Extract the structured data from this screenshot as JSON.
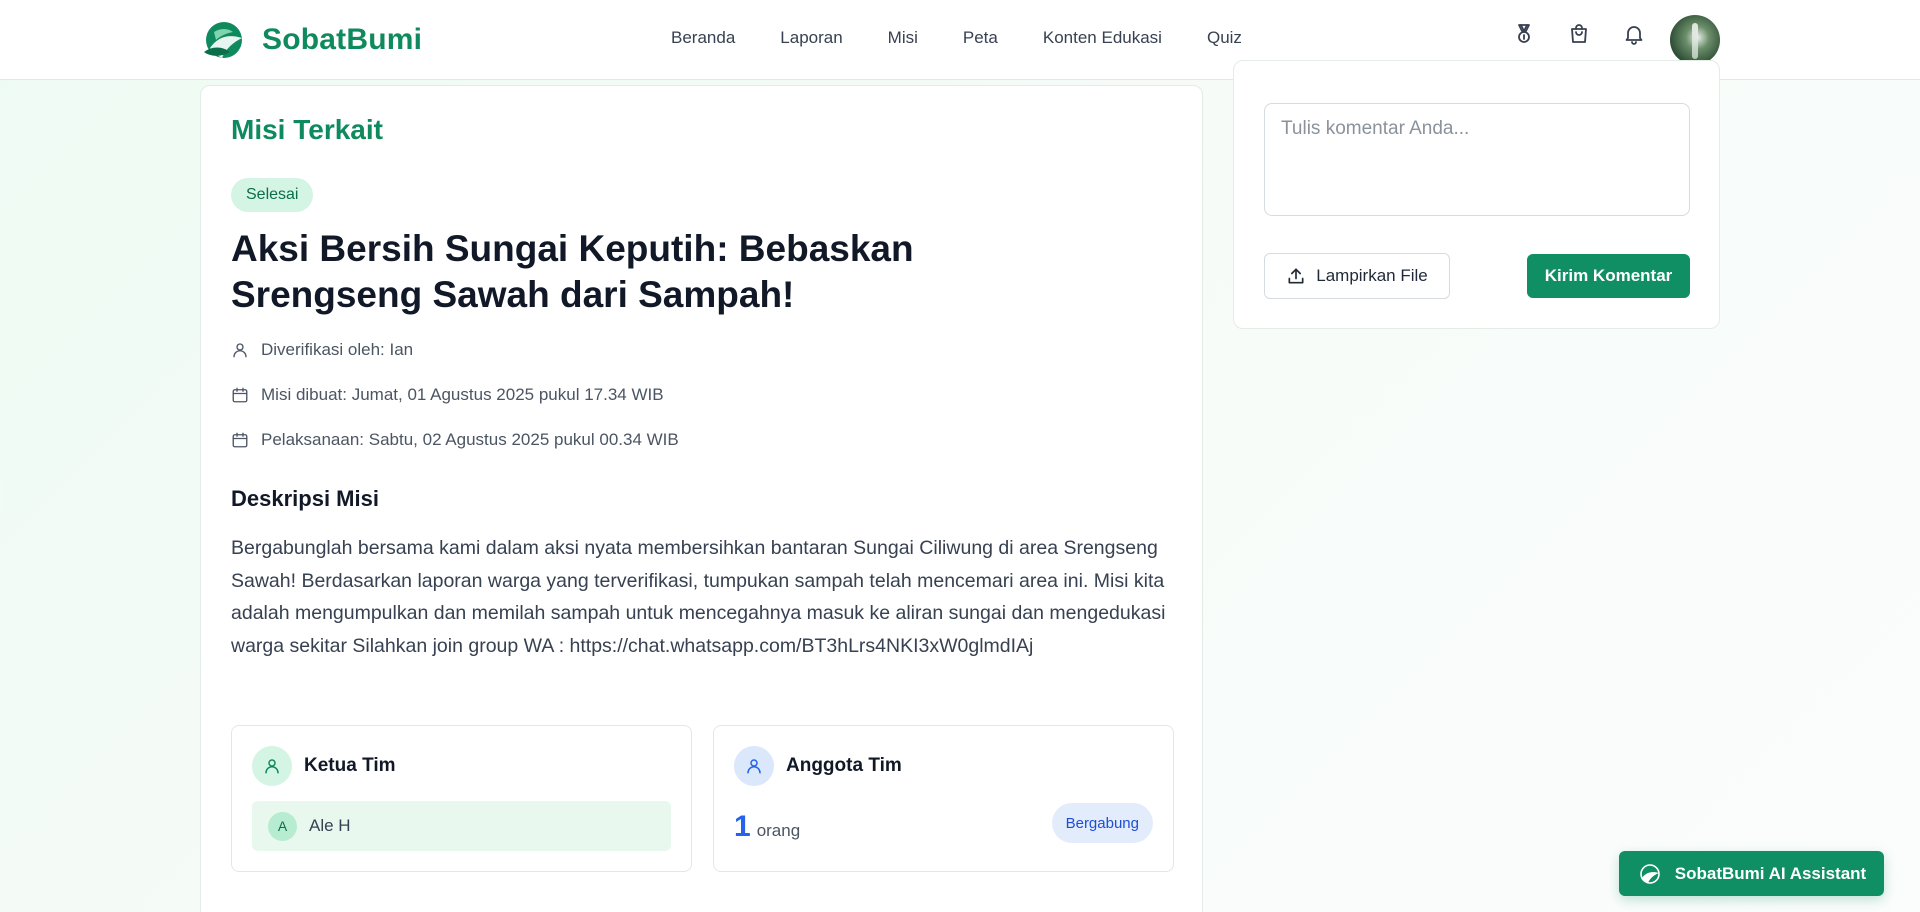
{
  "app": {
    "name": "SobatBumi",
    "brand_color": "#0f8a5f"
  },
  "nav": {
    "items": [
      "Beranda",
      "Laporan",
      "Misi",
      "Peta",
      "Konten Edukasi",
      "Quiz"
    ]
  },
  "header_icons": [
    "medal-icon",
    "shopping-bag-icon",
    "bell-icon",
    "user-avatar"
  ],
  "mission": {
    "section_title": "Misi Terkait",
    "status": "Selesai",
    "title": "Aksi Bersih Sungai Keputih: Bebaskan Srengseng Sawah dari Sampah!",
    "verified_by": "Diverifikasi oleh: Ian",
    "created_at": "Misi dibuat: Jumat, 01 Agustus 2025 pukul 17.34 WIB",
    "execution": "Pelaksanaan: Sabtu, 02 Agustus 2025 pukul 00.34 WIB",
    "description_heading": "Deskripsi Misi",
    "description": "Bergabunglah bersama kami dalam aksi nyata membersihkan bantaran Sungai Ciliwung di area Srengseng Sawah! Berdasarkan laporan warga yang terverifikasi, tumpukan sampah telah mencemari area ini. Misi kita adalah mengumpulkan dan memilah sampah untuk mencegahnya masuk ke aliran sungai dan mengedukasi warga sekitar Silahkan join group WA : https://chat.whatsapp.com/BT3hLrs4NKI3xW0glmdIAj"
  },
  "team": {
    "leader_label": "Ketua Tim",
    "leader_initial": "A",
    "leader_name": "Ale H",
    "members_label": "Anggota Tim",
    "member_count": "1",
    "member_unit": "orang",
    "join_label": "Bergabung"
  },
  "comment": {
    "placeholder": "Tulis komentar Anda...",
    "attach_label": "Lampirkan File",
    "send_label": "Kirim Komentar"
  },
  "assistant": {
    "label": "SobatBumi AI Assistant"
  }
}
